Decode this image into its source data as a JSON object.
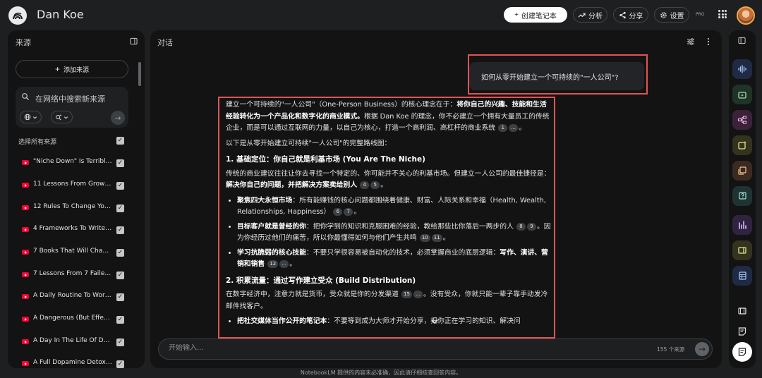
{
  "app": {
    "title": "Dan Koe"
  },
  "header": {
    "create_label": "创建笔记本",
    "analyze_label": "分析",
    "share_label": "分享",
    "settings_label": "设置",
    "pro_badge": "PRO"
  },
  "sources": {
    "title": "来源",
    "add_label": "添加来源",
    "search_placeholder": "在网络中搜索新来源",
    "select_all_label": "选择所有来源",
    "items": [
      "\"Niche Down\" Is Terrible ...",
      "11 Lessons From Growin...",
      "12 Rules To Change Your...",
      "4 Frameworks To Write F...",
      "7 Books That Will Chang...",
      "7 Lessons From 7 Failed ...",
      "A Daily Routine To Work ...",
      "A Dangerous (But Effecti...",
      "A Day In The Life Of Dan...",
      "A Full Dopamine Detox P..."
    ]
  },
  "chat": {
    "title": "对话",
    "user_message": "如何从零开始建立一个可持续的\"一人公司\"?",
    "answer": {
      "p1_a": "建立一个可持续的\"一人公司\"（One-Person Business）的核心理念在于：",
      "p1_b": "将你自己的兴趣、技能和生活经验转化为一个产品化和数字化的商业模式。",
      "p1_c": "根据 Dan Koe 的理念，你不必建立一个拥有大量员工的传统企业，而是可以通过互联网的力量，以自己为核心，打造一个高利润、高杠杆的商业系统",
      "p2": "以下是从零开始建立可持续\"一人公司\"的完整路线图：",
      "h1": "1. 基础定位：你自己就是利基市场 (You Are The Niche)",
      "p3_a": "传统的商业建议往往让你去寻找一个特定的、你可能并不关心的利基市场。但建立一人公司的最佳捷径是：",
      "p3_b": "解决你自己的问题，并把解决方案卖给别人",
      "li1_b": "聚焦四大永恒市场",
      "li1_t": "：所有能赚钱的核心问题都围绕着健康、财富、人际关系和幸福（Health, Wealth, Relationships, Happiness）",
      "li2_b": "目标客户就是曾经的你",
      "li2_t1": "：把你学到的知识和克服困难的经验，教给那些比你落后一两步的人",
      "li2_t2": "。因为你经历过他们的痛苦，所以你最懂得如何与他们产生共鸣",
      "li3_b": "学习抗脆弱的核心技能",
      "li3_t": "：不要只学很容易被自动化的技术，必须掌握商业的底层逻辑：",
      "li3_b2": "写作、演讲、营销和销售",
      "h2": "2. 积累流量：通过写作建立受众 (Build Distribution)",
      "p4": "在数字经济中，注意力就是货币，受众就是你的分发渠道",
      "p4_b": "。没有受众，你就只能一辈子靠手动发冷邮件找客户。",
      "li4_b": "把社交媒体当作公开的笔记本",
      "li4_t": "：不要等到成为大师才开始分享，把你正在学习的知识、解决问",
      "refs": {
        "r1": "1",
        "r2": "...",
        "r4": "4",
        "r5": "5",
        "r6": "6",
        "r7": "7",
        "r8": "8",
        "r9": "9",
        "r10": "10",
        "r11": "11",
        "r12": "12",
        "r13": "...",
        "r15": "15",
        "r16": "..."
      }
    },
    "input_placeholder": "开始输入...",
    "source_count": "155 个来源"
  },
  "footer": {
    "disclaimer": "NotebookLM 提供的内容未必准确，因此请仔细核查回答内容。"
  },
  "colors": {
    "highlight": "#e05454",
    "background": "#1e1f20",
    "panel": "#131314"
  }
}
